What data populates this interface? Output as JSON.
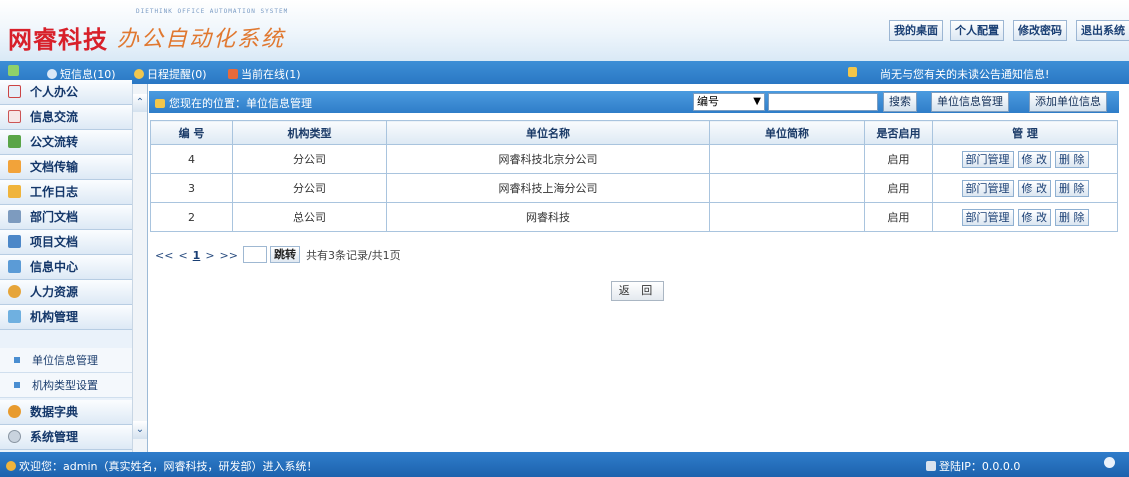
{
  "header": {
    "logo_main": "网睿科技",
    "logo_sub": "办公自动化系统",
    "logo_en": "DIETHINK OFFICE AUTOMATION SYSTEM",
    "buttons": [
      "我的桌面",
      "个人配置",
      "修改密码",
      "退出系统"
    ]
  },
  "toolbar": {
    "messages": "短信息(10)",
    "schedule": "日程提醒(0)",
    "online": "当前在线(1)",
    "notice": "尚无与您有关的未读公告通知信息!"
  },
  "sidebar": {
    "items": [
      {
        "label": "个人办公",
        "icon": "personal-office-icon"
      },
      {
        "label": "信息交流",
        "icon": "info-exchange-icon"
      },
      {
        "label": "公文流转",
        "icon": "document-flow-icon"
      },
      {
        "label": "文档传输",
        "icon": "file-transfer-icon"
      },
      {
        "label": "工作日志",
        "icon": "work-log-icon"
      },
      {
        "label": "部门文档",
        "icon": "dept-docs-icon"
      },
      {
        "label": "项目文档",
        "icon": "project-docs-icon"
      },
      {
        "label": "信息中心",
        "icon": "info-center-icon"
      },
      {
        "label": "人力资源",
        "icon": "hr-icon"
      },
      {
        "label": "机构管理",
        "icon": "org-management-icon"
      }
    ],
    "sub_items": [
      "单位信息管理",
      "机构类型设置"
    ],
    "bottom_items": [
      {
        "label": "数据字典",
        "icon": "data-dict-icon"
      },
      {
        "label": "系统管理",
        "icon": "system-management-icon"
      }
    ]
  },
  "main": {
    "breadcrumb": "您现在的位置：单位信息管理",
    "search_field": "编号",
    "search_value": "",
    "search_button": "搜索",
    "manage_button": "单位信息管理",
    "add_button": "添加单位信息",
    "table": {
      "headers": [
        "编 号",
        "机构类型",
        "单位名称",
        "单位简称",
        "是否启用",
        "管 理"
      ],
      "rows": [
        {
          "id": "4",
          "type": "分公司",
          "name": "网睿科技北京分公司",
          "short": "",
          "enabled": "启用"
        },
        {
          "id": "3",
          "type": "分公司",
          "name": "网睿科技上海分公司",
          "short": "",
          "enabled": "启用"
        },
        {
          "id": "2",
          "type": "总公司",
          "name": "网睿科技",
          "short": "",
          "enabled": "启用"
        }
      ],
      "actions": [
        "部门管理",
        "修 改",
        "删 除"
      ]
    },
    "pager": {
      "first": "<<",
      "prev": "<",
      "current": "1",
      "next": ">",
      "last": ">>",
      "jump": "跳转",
      "summary": "共有3条记录/共1页"
    },
    "back_button": "返 回"
  },
  "status": {
    "welcome": "欢迎您：admin（真实姓名，网睿科技，研发部）进入系统！",
    "ip": "登陆IP：0.0.0.0"
  }
}
